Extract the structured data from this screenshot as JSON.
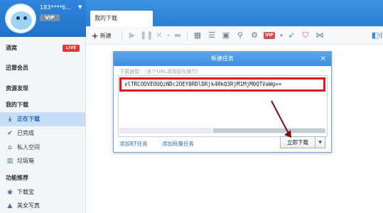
{
  "profile": {
    "username": "183****6...",
    "vip_badge": "VIP"
  },
  "sidebar": {
    "items": [
      {
        "label": "酒窝",
        "badge": "LIVE"
      },
      {
        "label": "迅雷会员"
      },
      {
        "label": "资源发现"
      },
      {
        "label": "我的下载"
      },
      {
        "label": "正在下载",
        "icon": "download-icon"
      },
      {
        "label": "已完成",
        "icon": "check-icon"
      },
      {
        "label": "私人空间",
        "icon": "lock-icon"
      },
      {
        "label": "垃圾箱",
        "icon": "trash-icon"
      },
      {
        "label": "功能推荐"
      },
      {
        "label": "下载宝",
        "icon": "download-box-icon"
      },
      {
        "label": "美女写真",
        "icon": "photo-icon"
      }
    ]
  },
  "tabs": [
    {
      "label": "我的下载"
    }
  ],
  "toolbar": {
    "new_label": "新建",
    "vip_label": "VIP",
    "more_label": "小"
  },
  "dialog": {
    "title": "新建任务",
    "close": "×",
    "url_label": "下载链接：（多个URL请用回车换行）",
    "url_value": "vlTRCODVEOUQzNDc2OEY0RDlDRjk4RkQ3RjM1MjM0QTVaWg==",
    "link_bt": "添加BT任务",
    "link_batch": "添加批量任务",
    "download_button": "立即下载",
    "dropdown": "▼"
  },
  "colors": {
    "accent": "#2a7fd4",
    "highlight_box": "#e3161c",
    "arrow": "#7a0f0f",
    "link": "#2d6fc6"
  }
}
